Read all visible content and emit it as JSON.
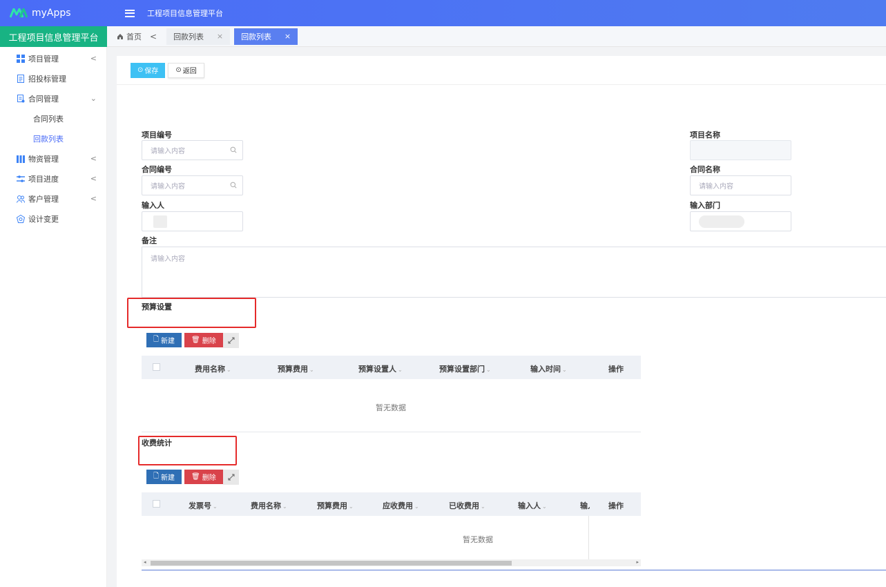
{
  "header": {
    "logo": "M",
    "app_name": "myApps",
    "app_title": "工程项目信息管理平台"
  },
  "platform_title": "工程项目信息管理平台",
  "tabs": {
    "home": "首页",
    "prev": "<",
    "items": [
      {
        "label": "回款列表",
        "close": "×"
      },
      {
        "label": "回款列表",
        "close": "×"
      }
    ]
  },
  "sidebar": {
    "items": [
      {
        "label": "项目管理",
        "icon": "grid-icon",
        "chevron": "<"
      },
      {
        "label": "招投标管理",
        "icon": "document-icon",
        "chevron": ""
      },
      {
        "label": "合同管理",
        "icon": "contract-icon",
        "chevron": "⌄"
      },
      {
        "label": "物资管理",
        "icon": "bars-icon",
        "chevron": "<"
      },
      {
        "label": "项目进度",
        "icon": "progress-icon",
        "chevron": "<"
      },
      {
        "label": "客户管理",
        "icon": "users-icon",
        "chevron": "<"
      },
      {
        "label": "设计变更",
        "icon": "design-icon",
        "chevron": ""
      }
    ],
    "subitems": [
      {
        "label": "合同列表"
      },
      {
        "label": "回款列表"
      }
    ]
  },
  "toolbar": {
    "save": "保存",
    "back": "返回"
  },
  "form": {
    "project_no_label": "项目编号",
    "project_no_placeholder": "请输入内容",
    "project_name_label": "项目名称",
    "contract_no_label": "合同编号",
    "contract_no_placeholder": "请输入内容",
    "contract_name_label": "合同名称",
    "contract_name_placeholder": "请输入内容",
    "input_person_label": "输入人",
    "input_dept_label": "输入部门",
    "remark_label": "备注",
    "remark_placeholder": "请输入内容"
  },
  "budget": {
    "title": "预算设置",
    "new": "新建",
    "delete": "删除",
    "columns": [
      "费用名称",
      "预算费用",
      "预算设置人",
      "预算设置部门",
      "输入时间",
      "操作"
    ],
    "empty": "暂无数据"
  },
  "fees": {
    "title": "收费统计",
    "new": "新建",
    "delete": "删除",
    "columns": [
      "发票号",
      "费用名称",
      "预算费用",
      "应收费用",
      "已收费用",
      "输入人",
      "输入",
      "操作"
    ],
    "empty": "暂无数据"
  },
  "colors": {
    "topbar": "#4a6cf7",
    "platform": "#18b383",
    "accent": "#4a6cf7",
    "save": "#3ec1f4",
    "new": "#2f6fb5",
    "delete": "#d9434b",
    "highlight": "#e52a2a"
  }
}
